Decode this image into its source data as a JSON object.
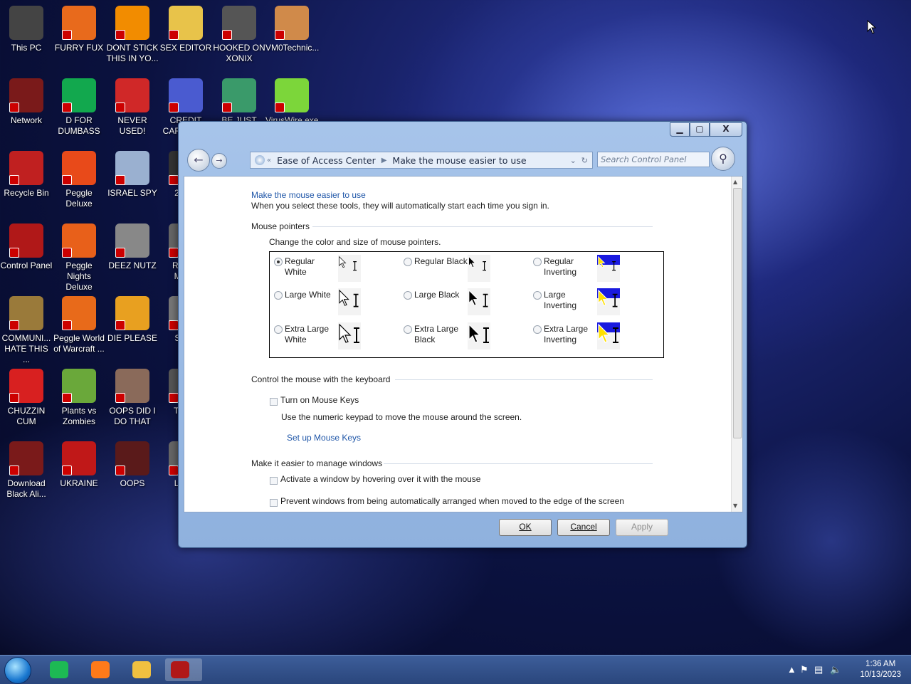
{
  "desktop": {
    "icons": [
      {
        "label": "This PC",
        "color": "#444"
      },
      {
        "label": "FURRY FUX",
        "color": "#e86a1c"
      },
      {
        "label": "DONT STICK THIS IN YO...",
        "color": "#f28c00"
      },
      {
        "label": "SEX EDITOR",
        "color": "#e8c34a"
      },
      {
        "label": "HOOKED ON XONIX",
        "color": "#555"
      },
      {
        "label": "VM0Technic...",
        "color": "#d08a4a"
      },
      {
        "label": "Network",
        "color": "#7a1a1a"
      },
      {
        "label": "D FOR DUMBASS",
        "color": "#12a84e"
      },
      {
        "label": "NEVER USED!",
        "color": "#d02828"
      },
      {
        "label": "CREDIT CARD CH...",
        "color": "#4a5bd0"
      },
      {
        "label": "BE JUST LIKE",
        "color": "#3a9a6a"
      },
      {
        "label": "VirusWire.exe",
        "color": "#7cd63a"
      },
      {
        "label": "Recycle Bin",
        "color": "#c02020"
      },
      {
        "label": "Peggle Deluxe",
        "color": "#e84a1a"
      },
      {
        "label": "ISRAEL SPY",
        "color": "#9ab0d0"
      },
      {
        "label": "2PA...",
        "color": "#333"
      },
      {
        "label": "Control Panel",
        "color": "#b01818"
      },
      {
        "label": "Peggle Nights Deluxe",
        "color": "#e8601a"
      },
      {
        "label": "DEEZ NUTZ",
        "color": "#888"
      },
      {
        "label": "Rans... Mak...",
        "color": "#666"
      },
      {
        "label": "COMMUNI... HATE THIS ...",
        "color": "#9a7a3a"
      },
      {
        "label": "Peggle World of Warcraft ...",
        "color": "#e86a1a"
      },
      {
        "label": "DIE PLEASE",
        "color": "#e8a020"
      },
      {
        "label": "Sup...",
        "color": "#777"
      },
      {
        "label": "CHUZZIN CUM",
        "color": "#d82020"
      },
      {
        "label": "Plants vs Zombies",
        "color": "#6aa83a"
      },
      {
        "label": "OOPS DID I DO THAT",
        "color": "#8a6a5a"
      },
      {
        "label": "The ...",
        "color": "#555"
      },
      {
        "label": "Download Black Ali...",
        "color": "#7a1a1a"
      },
      {
        "label": "UKRAINE",
        "color": "#c01818"
      },
      {
        "label": "OOPS",
        "color": "#5a1a1a"
      },
      {
        "label": "LYN...",
        "color": "#666"
      }
    ]
  },
  "window": {
    "titlebar": {
      "min": "▁",
      "max": "▢",
      "close": "X"
    },
    "nav": {
      "back_icon": "back-arrow-icon",
      "forward_icon": "forward-arrow-icon",
      "breadcrumb_prefix": "«",
      "breadcrumb": [
        "Ease of Access Center",
        "Make the mouse easier to use"
      ],
      "search_placeholder": "Search Control Panel"
    },
    "page": {
      "heading": "Make the mouse easier to use",
      "intro": "When you select these tools, they will automatically start each time you sign in.",
      "pointers_section": "Mouse pointers",
      "pointers_desc": "Change the color and size of mouse pointers.",
      "pointer_options": [
        {
          "line1": "Regular",
          "line2": "White",
          "selected": true
        },
        {
          "line1": "Regular Black",
          "line2": "",
          "selected": false
        },
        {
          "line1": "Regular",
          "line2": "Inverting",
          "selected": false
        },
        {
          "line1": "Large White",
          "line2": "",
          "selected": false
        },
        {
          "line1": "Large Black",
          "line2": "",
          "selected": false
        },
        {
          "line1": "Large",
          "line2": "Inverting",
          "selected": false
        },
        {
          "line1": "Extra Large",
          "line2": "White",
          "selected": false
        },
        {
          "line1": "Extra Large",
          "line2": "Black",
          "selected": false
        },
        {
          "line1": "Extra Large",
          "line2": "Inverting",
          "selected": false
        }
      ],
      "keyboard_section": "Control the mouse with the keyboard",
      "mouse_keys_label": "Turn on Mouse Keys",
      "mouse_keys_desc": "Use the numeric keypad to move the mouse around the screen.",
      "mouse_keys_link": "Set up Mouse Keys",
      "windows_section": "Make it easier to manage windows",
      "hover_label": "Activate a window by hovering over it with the mouse",
      "prevent_label": "Prevent windows from being automatically arranged when moved to the edge of the screen"
    },
    "buttons": {
      "ok": "OK",
      "cancel": "Cancel",
      "apply": "Apply"
    }
  },
  "taskbar": {
    "apps": [
      {
        "name": "spotify",
        "color": "#1db954"
      },
      {
        "name": "firefox",
        "color": "#ff7a1a"
      },
      {
        "name": "file-explorer",
        "color": "#f0c040"
      },
      {
        "name": "control-panel",
        "color": "#b01818"
      }
    ],
    "time": "1:36 AM",
    "date": "10/13/2023"
  }
}
